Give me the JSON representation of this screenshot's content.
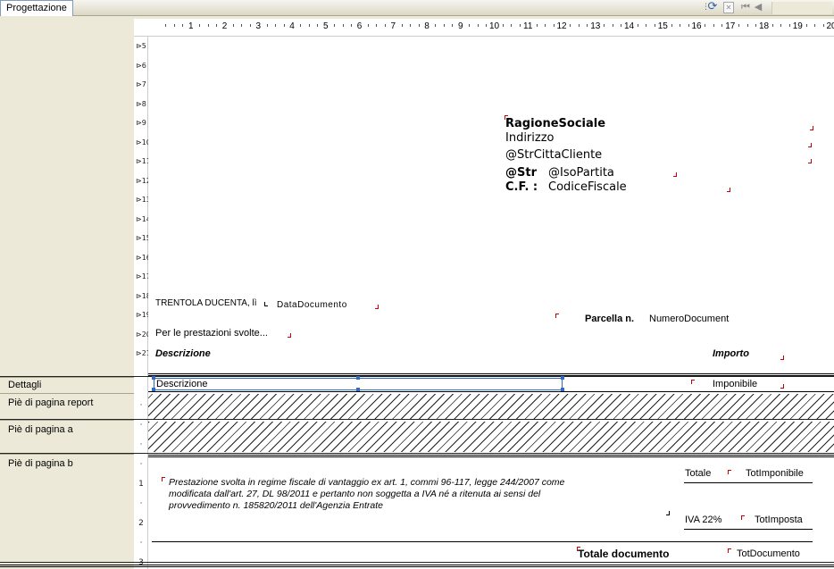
{
  "tab": {
    "label": "Progettazione"
  },
  "toolbar": {
    "grip_icon": "grip-icon",
    "refresh_icon": "refresh-icon",
    "close_icon": "close-document-icon",
    "first_icon": "first-page-icon",
    "prev_icon": "previous-page-icon"
  },
  "ruler": {
    "numbers": [
      "1",
      "2",
      "3",
      "4",
      "5",
      "6",
      "7",
      "8",
      "9",
      "10",
      "11",
      "12",
      "13",
      "14",
      "15",
      "16",
      "17",
      "18",
      "19",
      "20"
    ]
  },
  "vruler": {
    "marks": [
      "5",
      "6",
      "7",
      "8",
      "9",
      "10",
      "11",
      "12",
      "13",
      "14",
      "15",
      "16",
      "17",
      "18",
      "19",
      "20",
      "21"
    ],
    "band_marks": [
      "·",
      "·",
      "·",
      "·",
      "1",
      "·",
      "2",
      "·",
      "3"
    ]
  },
  "sections": {
    "details": "Dettagli",
    "report_footer": "Piè di pagina report",
    "footer_a": "Piè di pagina a",
    "footer_b": "Piè di pagina b"
  },
  "header": {
    "company": "RagioneSociale",
    "address": "Indirizzo",
    "city": "@StrCittaCliente",
    "vat_label": "@Str",
    "vat_value": "@IsoPartita",
    "cf_label": "C.F. :",
    "cf_value": "CodiceFiscale",
    "place_date_label": "TRENTOLA DUCENTA, lì",
    "date_field": "DataDocumento",
    "invoice_label": "Parcella n.",
    "invoice_field": "NumeroDocument",
    "services_text": "Per le prestazioni svolte...",
    "col_description": "Descrizione",
    "col_amount": "Importo"
  },
  "detail": {
    "description_field": "Descrizione",
    "taxable_field": "Imponibile"
  },
  "footer": {
    "note_line1": "Prestazione svolta in regime fiscale di vantaggio ex art. 1, commi 96-117, legge 244/2007 come",
    "note_line2": "modificata    dall'art. 27, DL 98/2011 e pertanto non soggetta a IVA né a ritenuta ai sensi del",
    "note_line3": "provvedimento n. 185820/2011 dell'Agenzia Entrate",
    "total_label": "Totale",
    "total_field": "TotImponibile",
    "vat_label": "IVA 22%",
    "vat_field": "TotImposta",
    "doc_total_label": "Totale documento",
    "doc_total_field": "TotDocumento"
  }
}
